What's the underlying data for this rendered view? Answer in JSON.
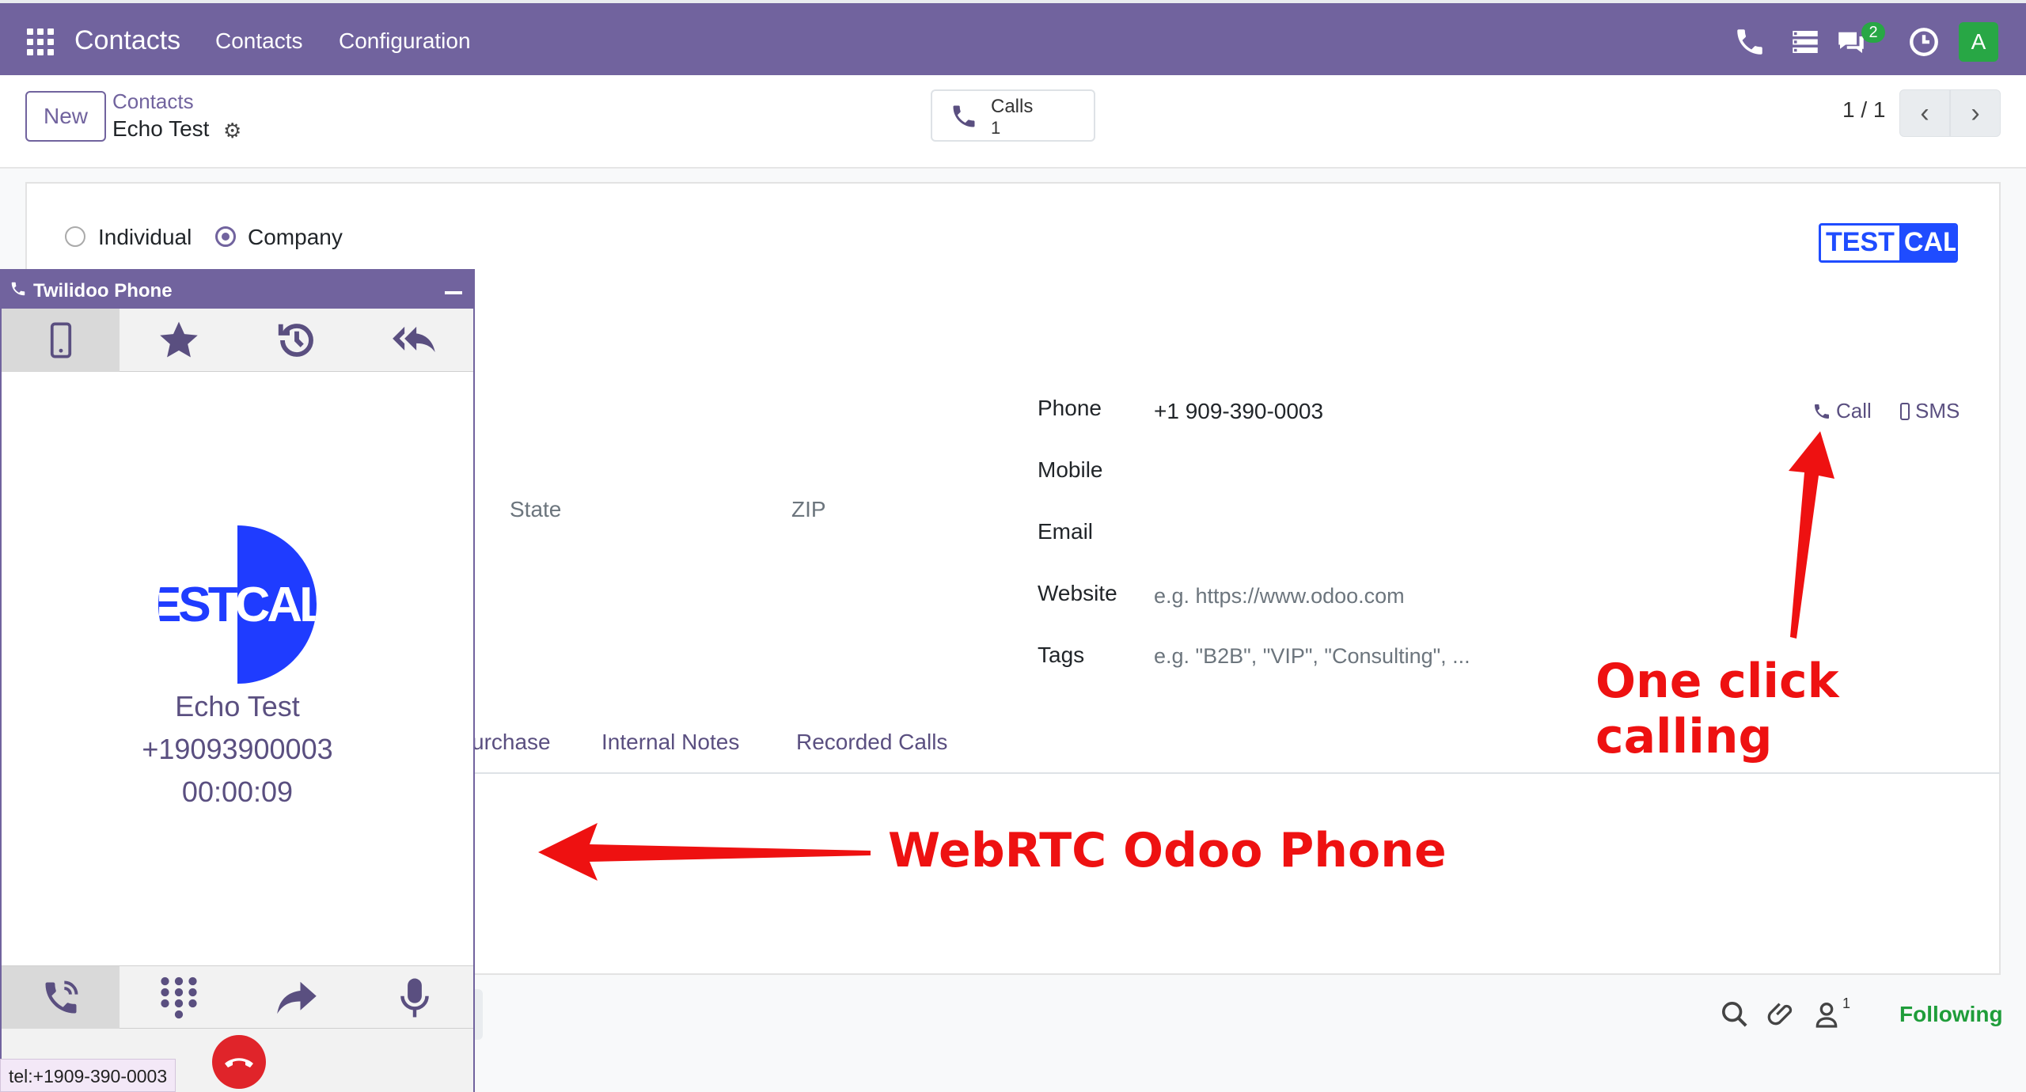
{
  "navbar": {
    "brand": "Contacts",
    "menu": [
      "Contacts",
      "Configuration"
    ],
    "chat_badge": "2",
    "avatar_letter": "A",
    "bg_color": "#71639e"
  },
  "control": {
    "new_label": "New",
    "breadcrumb_parent": "Contacts",
    "breadcrumb_current": "Echo Test",
    "calls_label": "Calls",
    "calls_count": "1",
    "pager": "1 / 1"
  },
  "form": {
    "type_individual": "Individual",
    "type_company": "Company",
    "logo_left": "TEST",
    "logo_right": "CALL",
    "address": {
      "state_placeholder": "State",
      "zip_placeholder": "ZIP"
    },
    "phone_label": "Phone",
    "phone_value": "+1 909-390-0003",
    "call_label": "Call",
    "sms_label": "SMS",
    "mobile_label": "Mobile",
    "email_label": "Email",
    "website_label": "Website",
    "website_placeholder": "e.g. https://www.odoo.com",
    "tags_label": "Tags",
    "tags_placeholder": "e.g. \"B2B\", \"VIP\", \"Consulting\", ...",
    "tabs": [
      "urchase",
      "Internal Notes",
      "Recorded Calls"
    ]
  },
  "chatter": {
    "follower_count": "1",
    "following_label": "Following"
  },
  "phone_widget": {
    "title": "Twilidoo Phone",
    "caller_name": "Echo Test",
    "caller_number": "+19093900003",
    "timer": "00:00:09",
    "logo_left": "TEST",
    "logo_right": "CALL"
  },
  "status_tooltip": "tel:+1909-390-0003",
  "annotations": {
    "one_click": "One click calling",
    "webrtc": "WebRTC Odoo Phone"
  }
}
